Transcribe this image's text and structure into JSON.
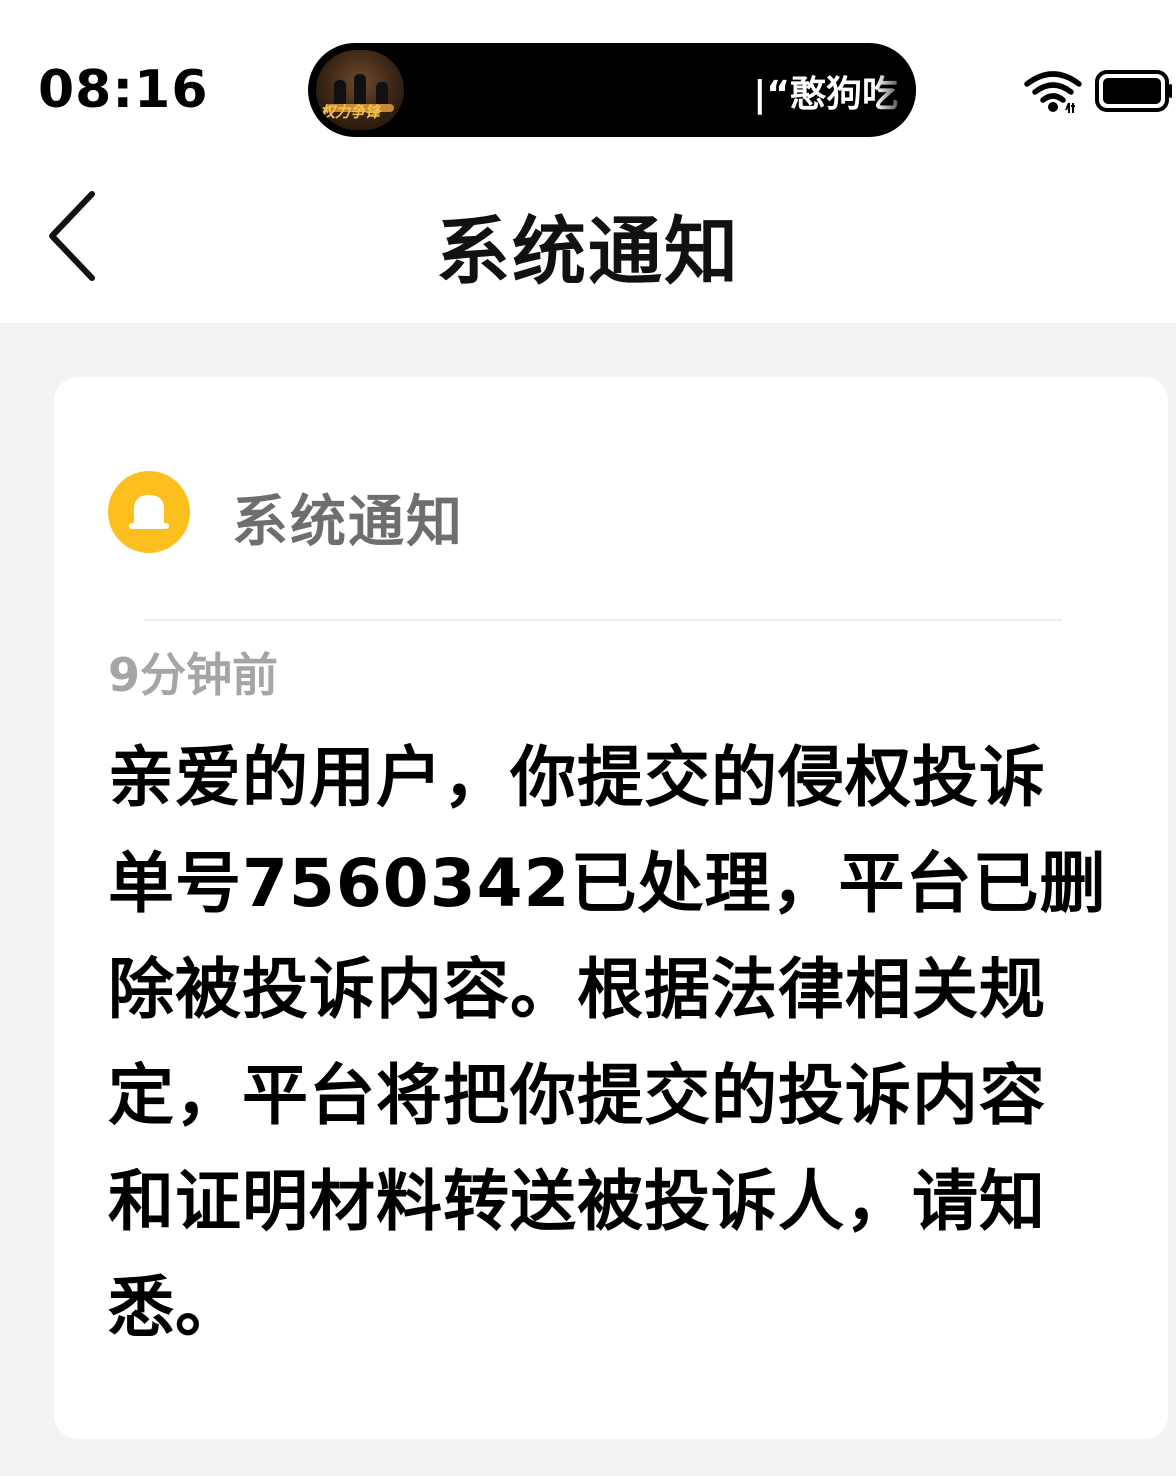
{
  "status_bar": {
    "time": "08:16",
    "media_thumbnail_text": "权力争锋",
    "media_ticker": "|“憨狗吃",
    "wifi_icon": "wifi-icon",
    "battery_icon": "battery-icon"
  },
  "nav": {
    "back_icon": "chevron-left-icon",
    "title": "系统通知"
  },
  "notification": {
    "sender_icon": "bell-icon",
    "sender_icon_color": "#fdbf1e",
    "sender": "系统通知",
    "timestamp": "9分钟前",
    "message": "亲爱的用户，你提交的侵权投诉单号7560342已处理，平台已删除被投诉内容。根据法律相关规定，平台将把你提交的投诉内容和证明材料转送被投诉人，请知悉。"
  }
}
